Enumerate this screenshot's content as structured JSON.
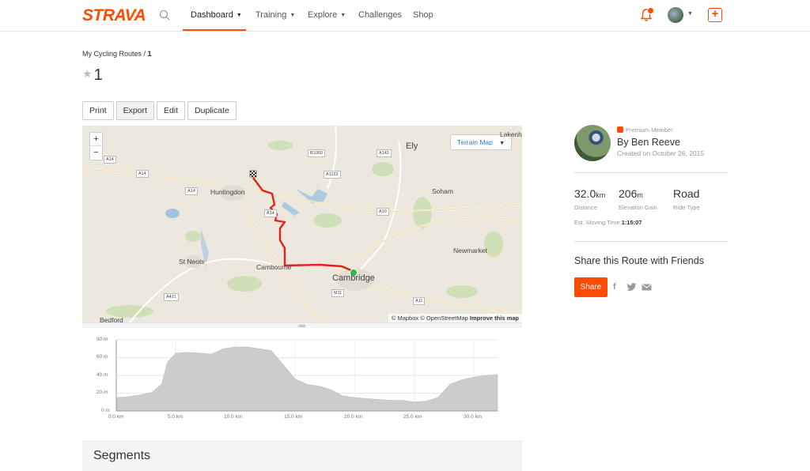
{
  "nav": {
    "logo": "STRAVA",
    "links": [
      {
        "label": "Dashboard",
        "caret": "⌄"
      },
      {
        "label": "Training",
        "caret": "⌄"
      },
      {
        "label": "Explore",
        "caret": "⌄"
      },
      {
        "label": "Challenges"
      },
      {
        "label": "Shop"
      }
    ],
    "active": "Dashboard",
    "accent": "#fc4c02"
  },
  "breadcrumb": {
    "parent": "My Cycling Routes",
    "sep": " / ",
    "current": "1"
  },
  "route": {
    "title": "1",
    "starred": false
  },
  "actions": [
    "Print",
    "Export",
    "Edit",
    "Duplicate"
  ],
  "map": {
    "terrain_button": "Terrain Map",
    "zoom_in": "+",
    "zoom_out": "−",
    "places": [
      "Ely",
      "Huntingdon",
      "Soham",
      "St Neots",
      "Newmarket",
      "Cambourne",
      "Cambridge",
      "Lakenh",
      "Bedford"
    ],
    "roads": [
      "A14",
      "A14",
      "A14",
      "B1050",
      "A142",
      "A1123",
      "A10",
      "A14",
      "A421",
      "M11",
      "A11"
    ],
    "attribution": {
      "mapbox": "© Mapbox",
      "osm": "© OpenStreetMap",
      "improve": "Improve this map"
    }
  },
  "elevation": {
    "y_ticks": [
      "80 m",
      "60 m",
      "40 m",
      "20 m",
      "0 m"
    ],
    "x_ticks": [
      "0.0 km",
      "5.0 km",
      "10.0 km",
      "15.0 km",
      "20.0 km",
      "25.0 km",
      "30.0 km"
    ]
  },
  "chart_data": {
    "type": "area",
    "x": [
      0,
      1,
      2,
      3,
      3.8,
      4.3,
      5,
      6,
      7,
      8,
      9,
      10,
      11,
      12,
      13,
      14,
      15,
      16,
      17,
      18,
      19,
      20,
      21,
      22,
      23,
      24,
      25,
      26,
      27,
      28,
      29,
      30,
      31,
      32
    ],
    "values": [
      15,
      16,
      18,
      21,
      30,
      55,
      65,
      66,
      65,
      64,
      70,
      72,
      72,
      70,
      68,
      52,
      36,
      30,
      28,
      24,
      17,
      15,
      14,
      13,
      12,
      12,
      10,
      11,
      15,
      30,
      35,
      38,
      40,
      41
    ],
    "xlabel": "",
    "ylabel": "",
    "xlim": [
      0,
      32
    ],
    "ylim": [
      0,
      80
    ],
    "fill_color": "#cccccc",
    "grid": true
  },
  "segments": {
    "title": "Segments"
  },
  "author": {
    "badge": "Premium Member",
    "name": "By Ben Reeve",
    "created": "Created on October 26, 2015"
  },
  "stats": [
    {
      "value": "32.0",
      "unit": "km",
      "label": "Distance"
    },
    {
      "value": "206",
      "unit": "m",
      "label": "Elevation Gain"
    },
    {
      "value": "Road",
      "unit": "",
      "label": "Ride Type"
    }
  ],
  "moving_time": {
    "label": "Est. Moving Time",
    "value": "1:15:07"
  },
  "share": {
    "title": "Share this Route with Friends",
    "button": "Share",
    "icons": [
      "facebook-icon",
      "twitter-icon",
      "mail-icon"
    ]
  }
}
